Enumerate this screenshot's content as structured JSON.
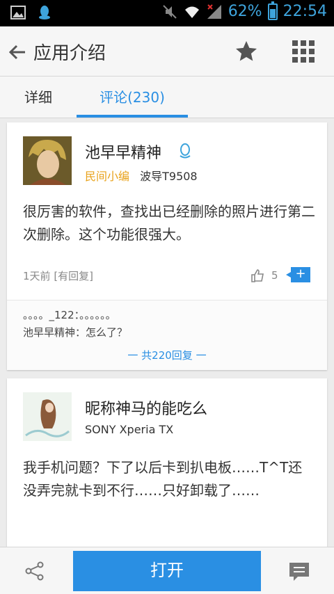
{
  "status_bar": {
    "battery": "62%",
    "time": "22:54"
  },
  "header": {
    "title": "应用介绍"
  },
  "tabs": {
    "detail": "详细",
    "comments": "评论(230)"
  },
  "comments": [
    {
      "username": "池早早精神",
      "tag": "民间小编",
      "device": "波导T9508",
      "text": "很厉害的软件，查找出已经删除的照片进行第二次删除。这个功能很强大。",
      "time": "1天前",
      "reply_status": "[有回复]",
      "likes": "5",
      "reply_button": "+",
      "replies": [
        "。。。。_122：。。。。。。",
        "池早早精神：怎么了？"
      ],
      "more_replies": "一 共220回复 一"
    },
    {
      "username": "昵称神马的能吃么",
      "device": "SONY Xperia TX",
      "text": "我手机问题？下了以后卡到扒电板……T^T还没弄完就卡到不行……只好卸载了……"
    }
  ],
  "bottom": {
    "open_label": "打开"
  }
}
